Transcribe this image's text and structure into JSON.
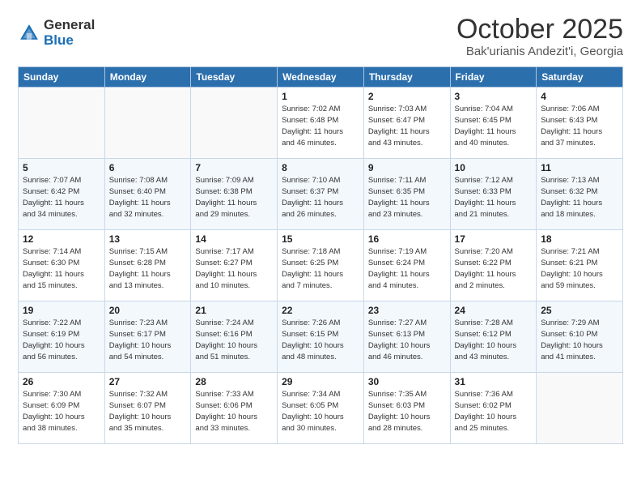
{
  "header": {
    "logo_general": "General",
    "logo_blue": "Blue",
    "month_title": "October 2025",
    "location": "Bak'urianis Andezit'i, Georgia"
  },
  "weekdays": [
    "Sunday",
    "Monday",
    "Tuesday",
    "Wednesday",
    "Thursday",
    "Friday",
    "Saturday"
  ],
  "weeks": [
    [
      {
        "day": "",
        "info": ""
      },
      {
        "day": "",
        "info": ""
      },
      {
        "day": "",
        "info": ""
      },
      {
        "day": "1",
        "info": "Sunrise: 7:02 AM\nSunset: 6:48 PM\nDaylight: 11 hours\nand 46 minutes."
      },
      {
        "day": "2",
        "info": "Sunrise: 7:03 AM\nSunset: 6:47 PM\nDaylight: 11 hours\nand 43 minutes."
      },
      {
        "day": "3",
        "info": "Sunrise: 7:04 AM\nSunset: 6:45 PM\nDaylight: 11 hours\nand 40 minutes."
      },
      {
        "day": "4",
        "info": "Sunrise: 7:06 AM\nSunset: 6:43 PM\nDaylight: 11 hours\nand 37 minutes."
      }
    ],
    [
      {
        "day": "5",
        "info": "Sunrise: 7:07 AM\nSunset: 6:42 PM\nDaylight: 11 hours\nand 34 minutes."
      },
      {
        "day": "6",
        "info": "Sunrise: 7:08 AM\nSunset: 6:40 PM\nDaylight: 11 hours\nand 32 minutes."
      },
      {
        "day": "7",
        "info": "Sunrise: 7:09 AM\nSunset: 6:38 PM\nDaylight: 11 hours\nand 29 minutes."
      },
      {
        "day": "8",
        "info": "Sunrise: 7:10 AM\nSunset: 6:37 PM\nDaylight: 11 hours\nand 26 minutes."
      },
      {
        "day": "9",
        "info": "Sunrise: 7:11 AM\nSunset: 6:35 PM\nDaylight: 11 hours\nand 23 minutes."
      },
      {
        "day": "10",
        "info": "Sunrise: 7:12 AM\nSunset: 6:33 PM\nDaylight: 11 hours\nand 21 minutes."
      },
      {
        "day": "11",
        "info": "Sunrise: 7:13 AM\nSunset: 6:32 PM\nDaylight: 11 hours\nand 18 minutes."
      }
    ],
    [
      {
        "day": "12",
        "info": "Sunrise: 7:14 AM\nSunset: 6:30 PM\nDaylight: 11 hours\nand 15 minutes."
      },
      {
        "day": "13",
        "info": "Sunrise: 7:15 AM\nSunset: 6:28 PM\nDaylight: 11 hours\nand 13 minutes."
      },
      {
        "day": "14",
        "info": "Sunrise: 7:17 AM\nSunset: 6:27 PM\nDaylight: 11 hours\nand 10 minutes."
      },
      {
        "day": "15",
        "info": "Sunrise: 7:18 AM\nSunset: 6:25 PM\nDaylight: 11 hours\nand 7 minutes."
      },
      {
        "day": "16",
        "info": "Sunrise: 7:19 AM\nSunset: 6:24 PM\nDaylight: 11 hours\nand 4 minutes."
      },
      {
        "day": "17",
        "info": "Sunrise: 7:20 AM\nSunset: 6:22 PM\nDaylight: 11 hours\nand 2 minutes."
      },
      {
        "day": "18",
        "info": "Sunrise: 7:21 AM\nSunset: 6:21 PM\nDaylight: 10 hours\nand 59 minutes."
      }
    ],
    [
      {
        "day": "19",
        "info": "Sunrise: 7:22 AM\nSunset: 6:19 PM\nDaylight: 10 hours\nand 56 minutes."
      },
      {
        "day": "20",
        "info": "Sunrise: 7:23 AM\nSunset: 6:17 PM\nDaylight: 10 hours\nand 54 minutes."
      },
      {
        "day": "21",
        "info": "Sunrise: 7:24 AM\nSunset: 6:16 PM\nDaylight: 10 hours\nand 51 minutes."
      },
      {
        "day": "22",
        "info": "Sunrise: 7:26 AM\nSunset: 6:15 PM\nDaylight: 10 hours\nand 48 minutes."
      },
      {
        "day": "23",
        "info": "Sunrise: 7:27 AM\nSunset: 6:13 PM\nDaylight: 10 hours\nand 46 minutes."
      },
      {
        "day": "24",
        "info": "Sunrise: 7:28 AM\nSunset: 6:12 PM\nDaylight: 10 hours\nand 43 minutes."
      },
      {
        "day": "25",
        "info": "Sunrise: 7:29 AM\nSunset: 6:10 PM\nDaylight: 10 hours\nand 41 minutes."
      }
    ],
    [
      {
        "day": "26",
        "info": "Sunrise: 7:30 AM\nSunset: 6:09 PM\nDaylight: 10 hours\nand 38 minutes."
      },
      {
        "day": "27",
        "info": "Sunrise: 7:32 AM\nSunset: 6:07 PM\nDaylight: 10 hours\nand 35 minutes."
      },
      {
        "day": "28",
        "info": "Sunrise: 7:33 AM\nSunset: 6:06 PM\nDaylight: 10 hours\nand 33 minutes."
      },
      {
        "day": "29",
        "info": "Sunrise: 7:34 AM\nSunset: 6:05 PM\nDaylight: 10 hours\nand 30 minutes."
      },
      {
        "day": "30",
        "info": "Sunrise: 7:35 AM\nSunset: 6:03 PM\nDaylight: 10 hours\nand 28 minutes."
      },
      {
        "day": "31",
        "info": "Sunrise: 7:36 AM\nSunset: 6:02 PM\nDaylight: 10 hours\nand 25 minutes."
      },
      {
        "day": "",
        "info": ""
      }
    ]
  ]
}
